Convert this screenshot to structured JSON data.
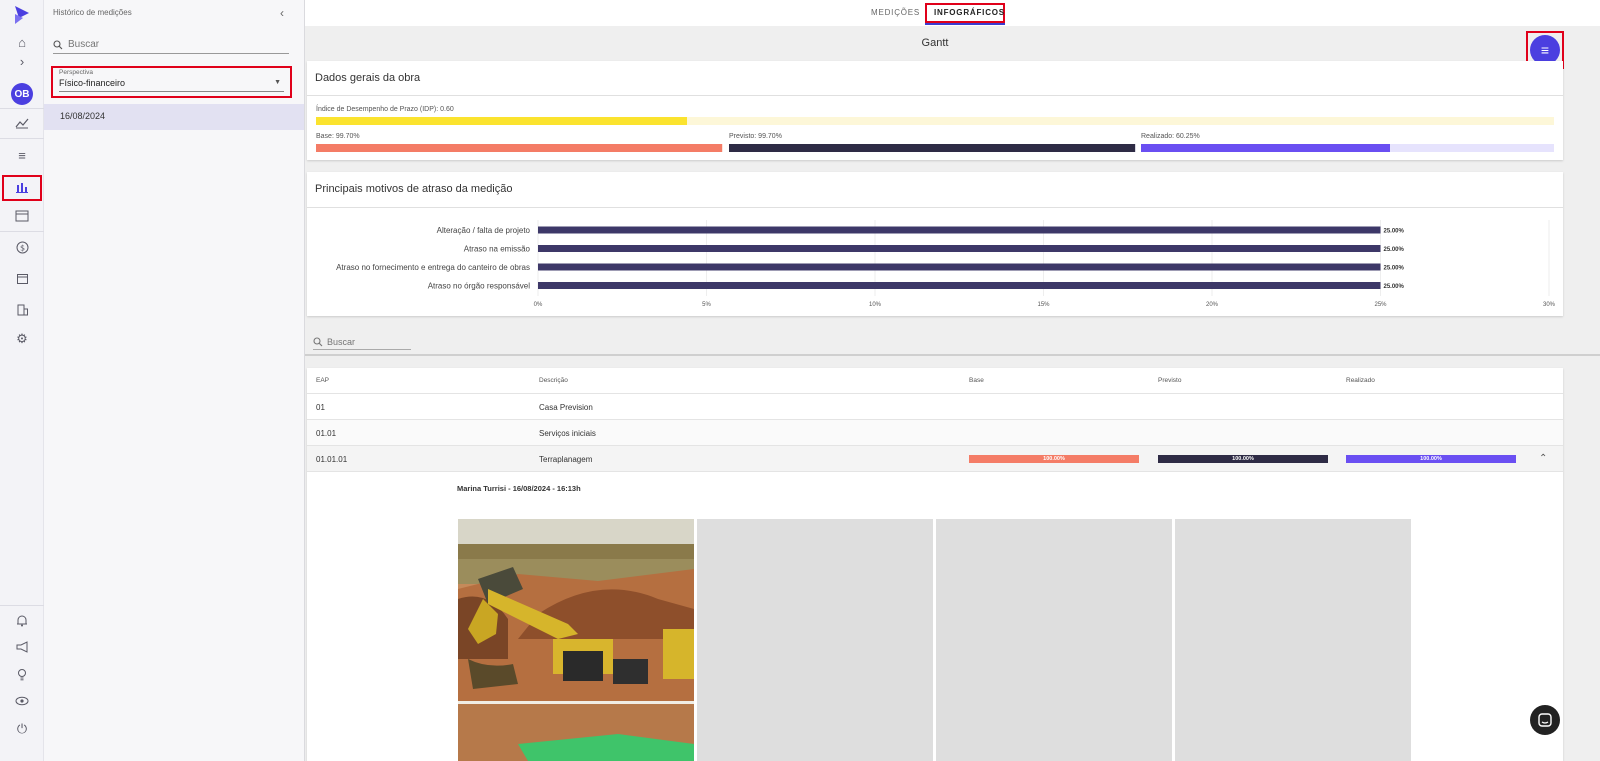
{
  "sidebar": {
    "title": "Histórico de medições",
    "search_placeholder": "Buscar",
    "perspective_label": "Perspectiva",
    "perspective_value": "Físico-financeiro",
    "avatar": "OB",
    "dates": [
      "16/08/2024"
    ]
  },
  "tabs": {
    "medicoes": "MEDIÇÕES",
    "infograficos": "INFOGRÁFICOS"
  },
  "page_title": "Gantt",
  "general": {
    "title": "Dados gerais da obra",
    "idp_label": "Índice de Desempenho de Prazo (IDP): 0.60",
    "idp_value": 0.6,
    "base_label": "Base: 99.70%",
    "base_value": 99.7,
    "previsto_label": "Previsto: 99.70%",
    "previsto_value": 99.7,
    "realizado_label": "Realizado: 60.25%",
    "realizado_value": 60.25
  },
  "delays": {
    "title": "Principais motivos de atraso da medição"
  },
  "chart_data": {
    "type": "bar",
    "orientation": "horizontal",
    "categories": [
      "Alteração / falta de projeto",
      "Atraso na emissão",
      "Atraso no fornecimento e entrega do canteiro de obras",
      "Atraso no órgão responsável"
    ],
    "values": [
      25.0,
      25.0,
      25.0,
      25.0
    ],
    "value_labels": [
      "25.00%",
      "25.00%",
      "25.00%",
      "25.00%"
    ],
    "xticks": [
      "0%",
      "5%",
      "10%",
      "15%",
      "20%",
      "25%",
      "30%"
    ],
    "xlim": [
      0,
      30
    ],
    "grid": true,
    "color": "#3d3868"
  },
  "table": {
    "search_placeholder": "Buscar",
    "headers": {
      "eap": "EAP",
      "desc": "Descrição",
      "base": "Base",
      "previsto": "Previsto",
      "realizado": "Realizado"
    },
    "rows": [
      {
        "eap": "01",
        "desc": "Casa Prevision"
      },
      {
        "eap": "01.01",
        "desc": "Serviços iniciais"
      },
      {
        "eap": "01.01.01",
        "desc": "Terraplanagem",
        "base": "100.00%",
        "previsto": "100.00%",
        "realizado": "100.00%"
      }
    ],
    "photo_meta": "Marina Turrisi - 16/08/2024 - 16:13h"
  },
  "colors": {
    "accent": "#4b3fe0",
    "base": "#f47c66",
    "previsto": "#2e2b45",
    "realizado": "#6a4ff2",
    "idp": "#fbe32e",
    "highlight": "#e0001a"
  }
}
